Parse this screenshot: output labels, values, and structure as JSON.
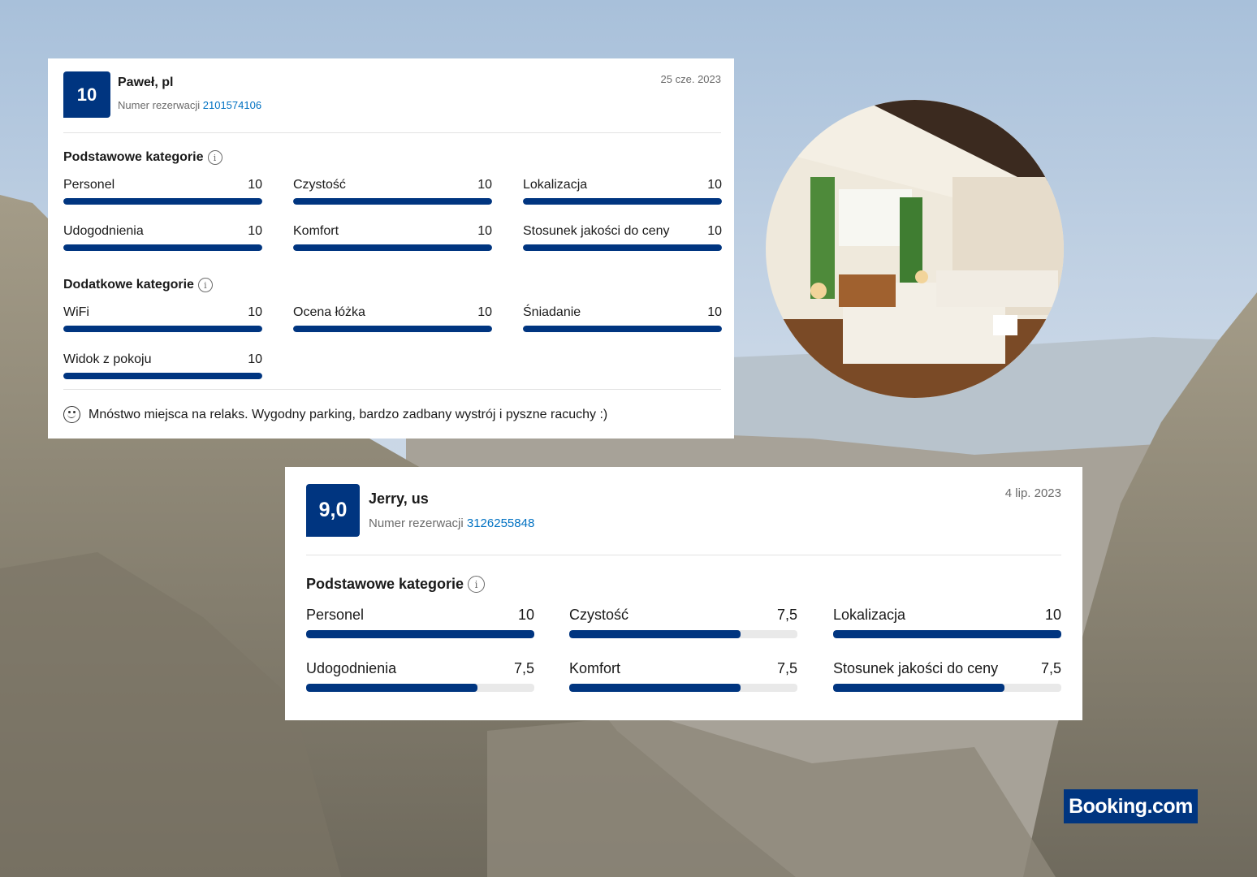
{
  "review1": {
    "score": "10",
    "reviewer": "Paweł, pl",
    "reservation_label": "Numer rezerwacji",
    "reservation_number": "2101574106",
    "date": "25 cze. 2023",
    "basic_title": "Podstawowe kategorie",
    "basic": [
      {
        "label": "Personel",
        "value": "10",
        "pct": 100
      },
      {
        "label": "Czystość",
        "value": "10",
        "pct": 100
      },
      {
        "label": "Lokalizacja",
        "value": "10",
        "pct": 100
      },
      {
        "label": "Udogodnienia",
        "value": "10",
        "pct": 100
      },
      {
        "label": "Komfort",
        "value": "10",
        "pct": 100
      },
      {
        "label": "Stosunek jakości do ceny",
        "value": "10",
        "pct": 100
      }
    ],
    "extra_title": "Dodatkowe kategorie",
    "extra": [
      {
        "label": "WiFi",
        "value": "10",
        "pct": 100
      },
      {
        "label": "Ocena łóżka",
        "value": "10",
        "pct": 100
      },
      {
        "label": "Śniadanie",
        "value": "10",
        "pct": 100
      },
      {
        "label": "Widok z pokoju",
        "value": "10",
        "pct": 100
      }
    ],
    "comment": "Mnóstwo miejsca na relaks. Wygodny parking, bardzo zadbany wystrój i pyszne racuchy :)"
  },
  "review2": {
    "score": "9,0",
    "reviewer": "Jerry, us",
    "reservation_label": "Numer rezerwacji",
    "reservation_number": "3126255848",
    "date": "4 lip. 2023",
    "basic_title": "Podstawowe kategorie",
    "basic": [
      {
        "label": "Personel",
        "value": "10",
        "pct": 100
      },
      {
        "label": "Czystość",
        "value": "7,5",
        "pct": 75
      },
      {
        "label": "Lokalizacja",
        "value": "10",
        "pct": 100
      },
      {
        "label": "Udogodnienia",
        "value": "7,5",
        "pct": 75
      },
      {
        "label": "Komfort",
        "value": "7,5",
        "pct": 75
      },
      {
        "label": "Stosunek jakości do ceny",
        "value": "7,5",
        "pct": 75
      }
    ]
  },
  "logo": "Booking.com",
  "icons": {
    "info": "info-icon",
    "smile": "smile-icon"
  },
  "colors": {
    "brand": "#003580",
    "link": "#0071c2"
  }
}
